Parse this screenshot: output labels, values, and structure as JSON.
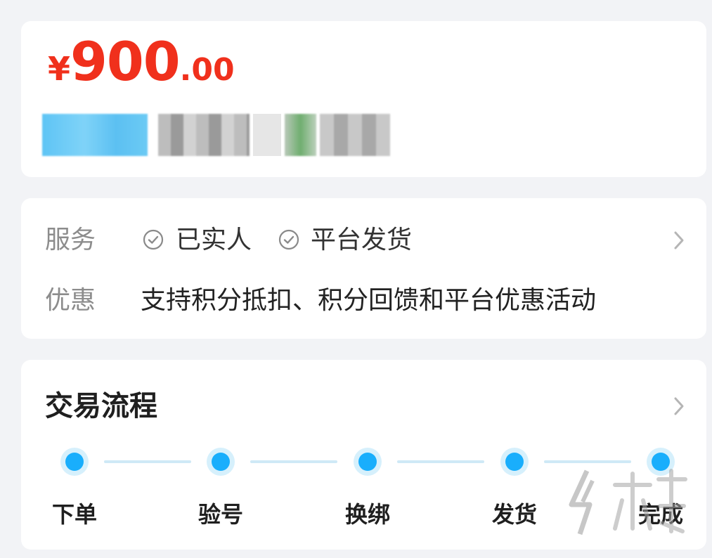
{
  "price": {
    "currency": "¥",
    "integer": "900",
    "decimal": ".00"
  },
  "service": {
    "label": "服务",
    "tags": [
      "已实人",
      "平台发货"
    ]
  },
  "promo": {
    "label": "优惠",
    "text": "支持积分抵扣、积分回馈和平台优惠活动"
  },
  "flow": {
    "title": "交易流程",
    "steps": [
      "下单",
      "验号",
      "换绑",
      "发货",
      "完成"
    ]
  },
  "colors": {
    "price": "#f0301c",
    "step_dot": "#19aefc",
    "step_line": "#cfe9f6"
  },
  "icons": [
    "check-circle-icon",
    "chevron-right-icon",
    "watermark-logo"
  ]
}
